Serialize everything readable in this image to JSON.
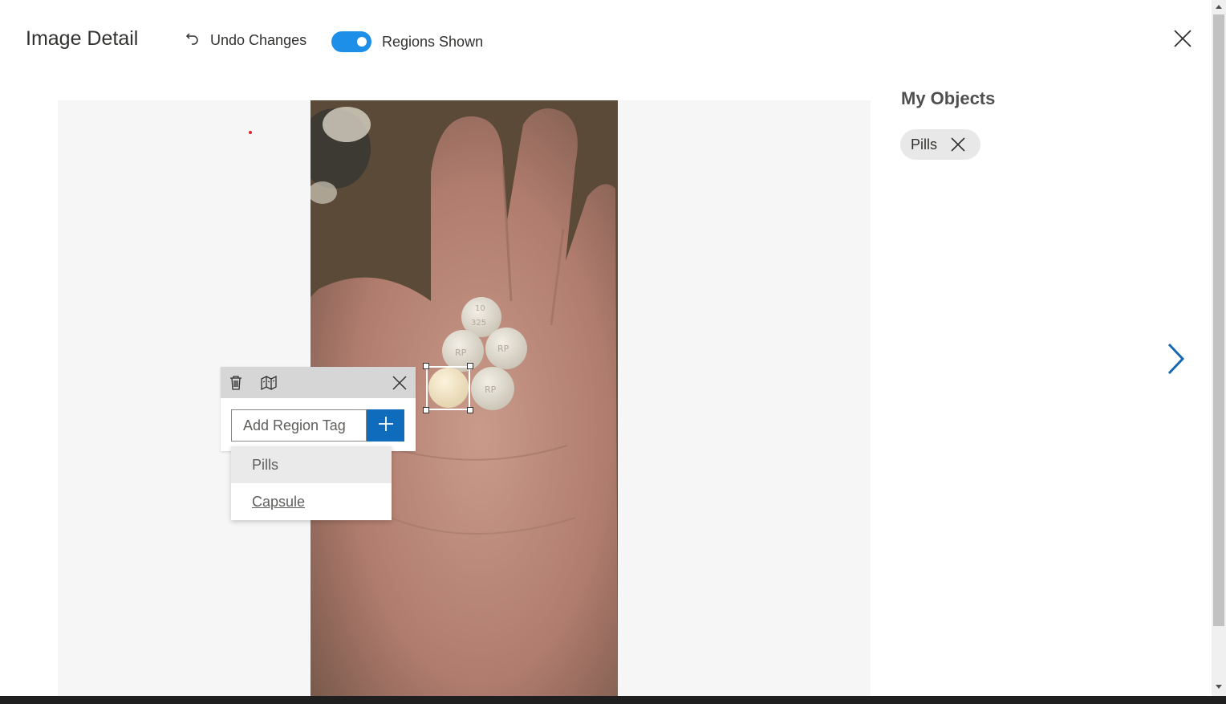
{
  "header": {
    "title": "Image Detail",
    "undo_label": "Undo Changes",
    "toggle_label": "Regions Shown",
    "toggle_on": true
  },
  "region_editor": {
    "input_placeholder": "Add Region Tag",
    "suggestions": [
      {
        "label": "Pills",
        "highlighted": true
      },
      {
        "label": "Capsule",
        "highlighted": false
      }
    ]
  },
  "objects_panel": {
    "title": "My Objects",
    "tags": [
      {
        "label": "Pills"
      }
    ]
  },
  "icons": {
    "undo": "undo-icon",
    "close": "close-icon",
    "delete": "trash-icon",
    "copy": "copy-region-icon",
    "add": "plus-icon",
    "next": "chevron-right-icon"
  },
  "colors": {
    "accent": "#1e8fe8",
    "button_primary": "#0f6cbd",
    "chevron": "#1768b2",
    "region_outline": "#ffffff"
  }
}
